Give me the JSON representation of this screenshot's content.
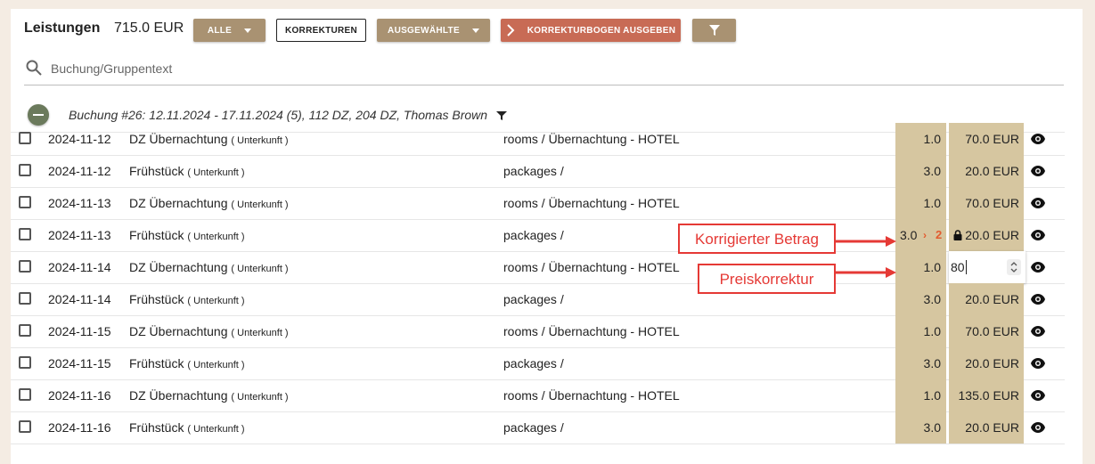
{
  "header": {
    "title": "Leistungen",
    "total": "715.0 EUR",
    "btn_all": "ALLE",
    "btn_corrections": "KORREKTUREN",
    "btn_selected": "AUSGEWÄHLTE",
    "btn_output": "KORREKTURBOGEN AUSGEBEN"
  },
  "search": {
    "placeholder": "Buchung/Gruppentext"
  },
  "group": {
    "label": "Buchung #26: 12.11.2024 - 17.11.2024 (5), 112 DZ, 204 DZ, Thomas Brown"
  },
  "rows": [
    {
      "date": "2024-11-12",
      "name": "DZ Übernachtung",
      "cat": "( Unterkunft )",
      "path": "rooms / Übernachtung - HOTEL",
      "qty": "1.0",
      "price": "70.0 EUR"
    },
    {
      "date": "2024-11-12",
      "name": "Frühstück",
      "cat": "( Unterkunft )",
      "path": "packages /",
      "qty": "3.0",
      "price": "20.0 EUR"
    },
    {
      "date": "2024-11-13",
      "name": "DZ Übernachtung",
      "cat": "( Unterkunft )",
      "path": "rooms / Übernachtung - HOTEL",
      "qty": "1.0",
      "price": "70.0 EUR"
    },
    {
      "date": "2024-11-13",
      "name": "Frühstück",
      "cat": "( Unterkunft )",
      "path": "packages /",
      "qty_old": "3.0",
      "qty_arrow": "›",
      "qty_new": "2",
      "price": "20.0 EUR"
    },
    {
      "date": "2024-11-14",
      "name": "DZ Übernachtung",
      "cat": "( Unterkunft )",
      "path": "rooms / Übernachtung - HOTEL",
      "qty": "1.0",
      "price_input": "80"
    },
    {
      "date": "2024-11-14",
      "name": "Frühstück",
      "cat": "( Unterkunft )",
      "path": "packages /",
      "qty": "3.0",
      "price": "20.0 EUR"
    },
    {
      "date": "2024-11-15",
      "name": "DZ Übernachtung",
      "cat": "( Unterkunft )",
      "path": "rooms / Übernachtung - HOTEL",
      "qty": "1.0",
      "price": "70.0 EUR"
    },
    {
      "date": "2024-11-15",
      "name": "Frühstück",
      "cat": "( Unterkunft )",
      "path": "packages /",
      "qty": "3.0",
      "price": "20.0 EUR"
    },
    {
      "date": "2024-11-16",
      "name": "DZ Übernachtung",
      "cat": "( Unterkunft )",
      "path": "rooms / Übernachtung - HOTEL",
      "qty": "1.0",
      "price": "135.0 EUR"
    },
    {
      "date": "2024-11-16",
      "name": "Frühstück",
      "cat": "( Unterkunft )",
      "path": "packages /",
      "qty": "3.0",
      "price": "20.0 EUR"
    }
  ],
  "annotations": {
    "corrected_amount": "Korrigierter Betrag",
    "price_correction": "Preiskorrektur"
  },
  "colors": {
    "accent_tan": "#a99272",
    "accent_red": "#c86b55",
    "cell_bg": "#d6c6a0",
    "annotation_red": "#e53935"
  }
}
